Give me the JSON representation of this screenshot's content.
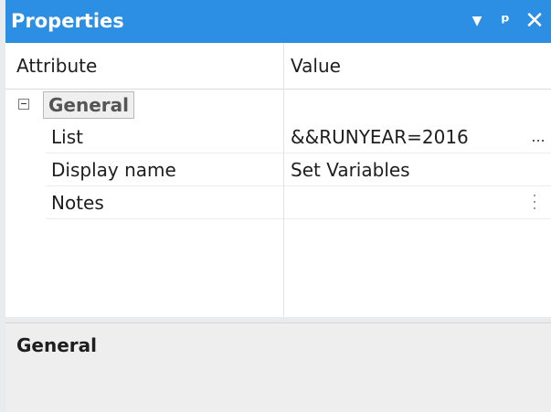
{
  "panel": {
    "title": "Properties",
    "buttons": {
      "dropdown": "▼",
      "pin": "ᵖ",
      "close": "✕"
    }
  },
  "grid": {
    "headers": {
      "attribute": "Attribute",
      "value": "Value"
    },
    "category": {
      "label": "General",
      "expanded": true
    },
    "rows": [
      {
        "name": "List",
        "value": "&&RUNYEAR=2016",
        "editor": "..."
      },
      {
        "name": "Display name",
        "value": "Set Variables"
      },
      {
        "name": "Notes",
        "value": ""
      }
    ]
  },
  "description": {
    "title": "General"
  },
  "colors": {
    "titlebar": "#2d8fe3",
    "description_bg": "#eeeeee"
  }
}
